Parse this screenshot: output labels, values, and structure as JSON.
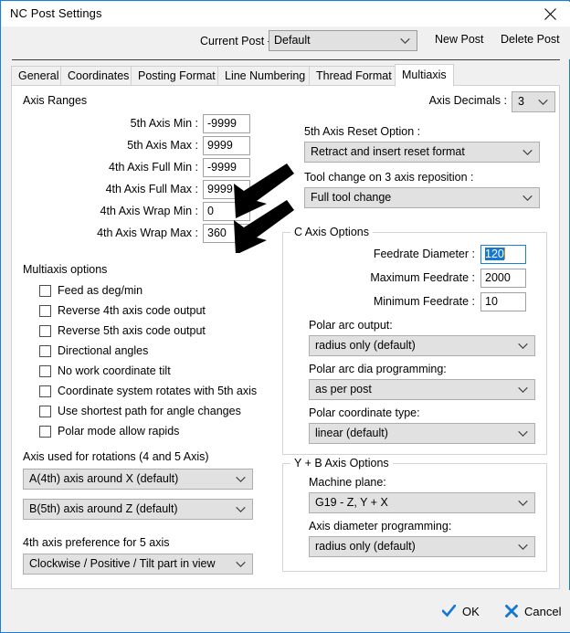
{
  "window": {
    "title": "NC Post Settings",
    "close_icon": "close-icon"
  },
  "post_selector": {
    "label": "Current Post -",
    "value": "Default",
    "new_post_label": "New Post",
    "delete_post_label": "Delete Post"
  },
  "tabs": [
    {
      "label": "General",
      "active": false
    },
    {
      "label": "Coordinates",
      "active": false
    },
    {
      "label": "Posting Format",
      "active": false
    },
    {
      "label": "Line Numbering",
      "active": false
    },
    {
      "label": "Thread Format",
      "active": false
    },
    {
      "label": "Multiaxis",
      "active": true
    }
  ],
  "axis_ranges": {
    "title": "Axis Ranges",
    "fields": [
      {
        "label": "5th Axis Min :",
        "value": "-9999"
      },
      {
        "label": "5th Axis Max :",
        "value": "9999"
      },
      {
        "label": "4th Axis Full Min :",
        "value": "-9999"
      },
      {
        "label": "4th Axis Full Max :",
        "value": "9999"
      },
      {
        "label": "4th Axis Wrap Min :",
        "value": "0"
      },
      {
        "label": "4th Axis Wrap Max :",
        "value": "360"
      }
    ]
  },
  "axis_decimals": {
    "label": "Axis Decimals :",
    "value": "3"
  },
  "fifth_axis_reset": {
    "label": "5th Axis Reset Option :",
    "value": "Retract and insert reset format"
  },
  "tool_change": {
    "label": "Tool change on 3 axis reposition :",
    "value": "Full tool change"
  },
  "multiaxis_options": {
    "title": "Multiaxis options",
    "items": [
      {
        "label": "Feed as deg/min",
        "checked": false
      },
      {
        "label": "Reverse 4th axis code output",
        "checked": false
      },
      {
        "label": "Reverse 5th axis code output",
        "checked": false
      },
      {
        "label": "Directional angles",
        "checked": false
      },
      {
        "label": "No work coordinate tilt",
        "checked": false
      },
      {
        "label": "Coordinate system rotates with 5th axis",
        "checked": false
      },
      {
        "label": "Use shortest path for angle changes",
        "checked": false
      },
      {
        "label": "Polar mode allow rapids",
        "checked": false
      }
    ]
  },
  "rotations": {
    "title": "Axis used for rotations (4 and 5 Axis)",
    "axis4": "A(4th) axis around X (default)",
    "axis5": "B(5th) axis around Z (default)"
  },
  "axis_preference": {
    "title": "4th axis preference for 5 axis",
    "value": "Clockwise / Positive / Tilt part in view"
  },
  "c_axis_options": {
    "title": "C Axis Options",
    "feedrate_diameter": {
      "label": "Feedrate Diameter :",
      "value": "120",
      "focused": true,
      "selected": true
    },
    "maximum_feedrate": {
      "label": "Maximum Feedrate :",
      "value": "2000"
    },
    "minimum_feedrate": {
      "label": "Minimum Feedrate :",
      "value": "10"
    },
    "polar_arc_output": {
      "label": "Polar arc output:",
      "value": "radius only (default)"
    },
    "polar_arc_dia": {
      "label": "Polar arc dia programming:",
      "value": "as per post"
    },
    "polar_coord_type": {
      "label": "Polar coordinate type:",
      "value": "linear (default)"
    }
  },
  "yb_axis_options": {
    "title": "Y + B Axis Options",
    "machine_plane": {
      "label": "Machine plane:",
      "value": "G19 - Z, Y + X"
    },
    "axis_diameter": {
      "label": "Axis diameter programming:",
      "value": "radius only (default)"
    }
  },
  "footer": {
    "ok_label": "OK",
    "cancel_label": "Cancel"
  },
  "annotation": {
    "arrow_count": 2,
    "arrow_color": "#000000"
  },
  "colors": {
    "accent": "#1b7fd4",
    "selection": "#1478d2",
    "window_bg": "#f0f0f0",
    "panel_bg": "#ffffff",
    "combo_bg": "#e1e1e1"
  }
}
